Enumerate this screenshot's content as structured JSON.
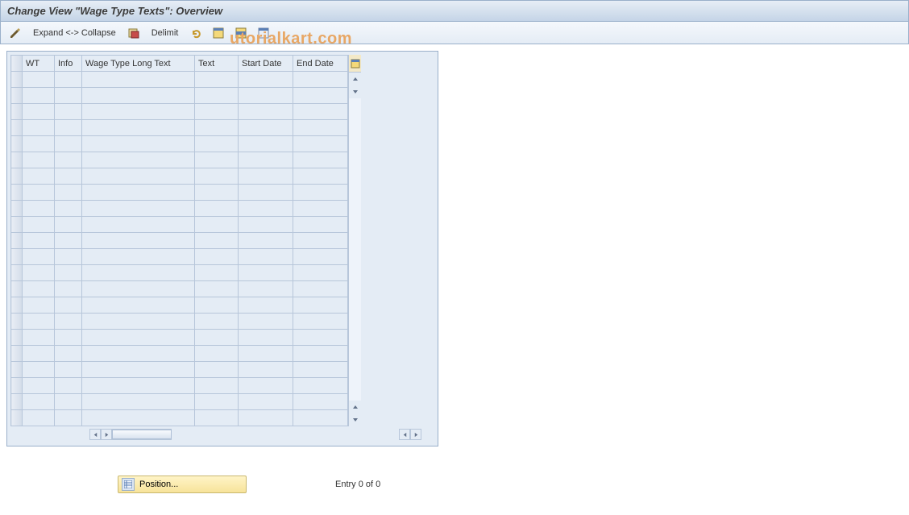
{
  "title": "Change View \"Wage Type Texts\": Overview",
  "toolbar": {
    "expand_collapse": "Expand <-> Collapse",
    "delimit": "Delimit"
  },
  "watermark": "utorialkart.com",
  "grid": {
    "columns": {
      "wt": "WT",
      "info": "Info",
      "long": "Wage Type Long Text",
      "text": "Text",
      "start": "Start Date",
      "end": "End Date"
    },
    "row_count": 22
  },
  "footer": {
    "position_label": "Position...",
    "entry_text": "Entry 0 of 0"
  },
  "icons": {
    "pencil": "pencil-icon",
    "delimit": "delimit-icon",
    "undo": "undo-icon",
    "select_all": "select-all-icon",
    "select_block": "select-block-icon",
    "deselect": "deselect-all-icon",
    "config": "table-settings-icon"
  }
}
